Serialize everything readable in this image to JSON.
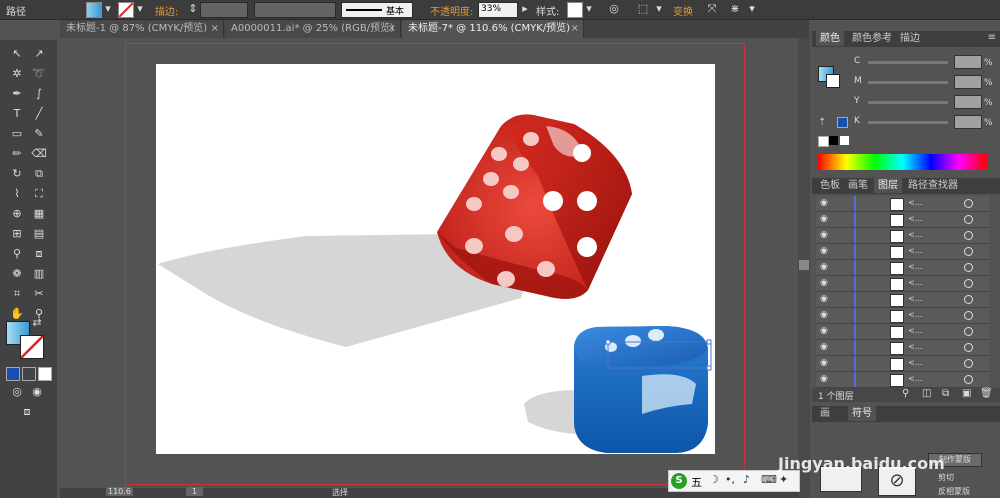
{
  "control_bar": {
    "path_label": "路径",
    "stroke_label": "描边:",
    "stroke_profile": "基本",
    "opacity_label": "不透明度:",
    "opacity_value": "33%",
    "style_label": "样式:",
    "transform_label": "变换"
  },
  "tabs": [
    {
      "label": "未标题-1 @ 87% (CMYK/预览)",
      "active": false
    },
    {
      "label": "A0000011.ai* @ 25% (RGB/预览)",
      "active": false
    },
    {
      "label": "未标题-7* @ 110.6% (CMYK/预览)",
      "active": true
    }
  ],
  "color_panel": {
    "tabs": [
      "颜色",
      "颜色参考",
      "描边"
    ],
    "channels": [
      {
        "label": "C",
        "unit": "%"
      },
      {
        "label": "M",
        "unit": "%"
      },
      {
        "label": "Y",
        "unit": "%"
      },
      {
        "label": "K",
        "unit": "%"
      }
    ]
  },
  "layers_panel": {
    "tabs": [
      "色板",
      "画笔",
      "图层",
      "路径查找器"
    ],
    "footer": "1 个图层",
    "row_count": 12
  },
  "artboards_panel": {
    "tabs": [
      "画",
      "符号"
    ],
    "buttons": [
      "制作蒙版",
      "剪切",
      "反相蒙版"
    ]
  },
  "status_bar": {
    "zoom": "110.6",
    "page": "1",
    "tool": "选择"
  },
  "ime": {
    "label": "五"
  },
  "watermark": "Jingyan.baidu.com",
  "colors": {
    "accent_red": "#c63434",
    "layer_blue": "#4a74d0",
    "die_red": "#c8201a",
    "die_blue": "#1a6ec0"
  }
}
